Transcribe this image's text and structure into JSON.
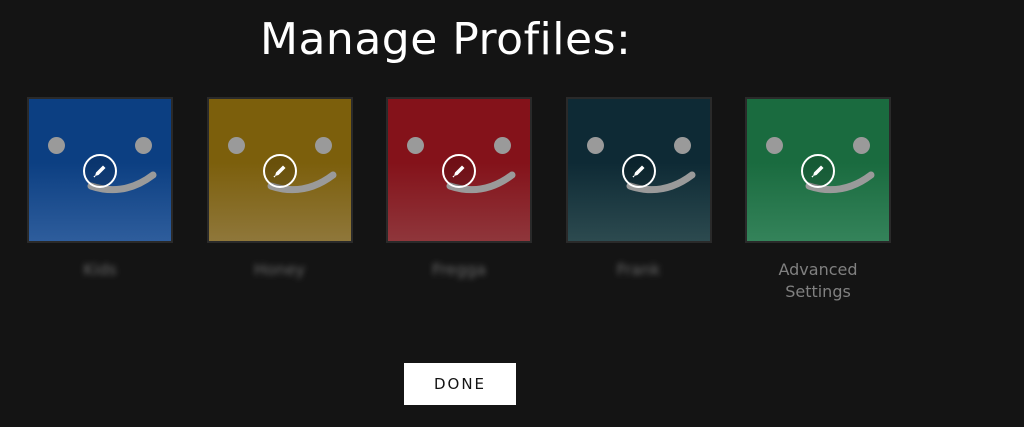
{
  "header": {
    "title": "Manage Profiles:"
  },
  "profiles": [
    {
      "name": "Kids",
      "blurred": true,
      "icon": "pencil-icon",
      "color_top": "#0c3f82",
      "color_bottom": "#2e5d9c"
    },
    {
      "name": "Honey",
      "blurred": true,
      "icon": "pencil-icon",
      "color_top": "#7c5f0c",
      "color_bottom": "#8f773a"
    },
    {
      "name": "Fregga",
      "blurred": true,
      "icon": "pencil-icon",
      "color_top": "#84121a",
      "color_bottom": "#8f363b"
    },
    {
      "name": "Frank",
      "blurred": true,
      "icon": "pencil-icon",
      "color_top": "#0e2a35",
      "color_bottom": "#2c4a4f"
    },
    {
      "name": "Advanced Settings",
      "blurred": false,
      "icon": "pencil-icon",
      "color_top": "#1a6b3f",
      "color_bottom": "#34835a"
    }
  ],
  "actions": {
    "done_label": "DONE"
  },
  "colors": {
    "background": "#141414",
    "face": "#9a9a9a",
    "button_bg": "#ffffff"
  }
}
